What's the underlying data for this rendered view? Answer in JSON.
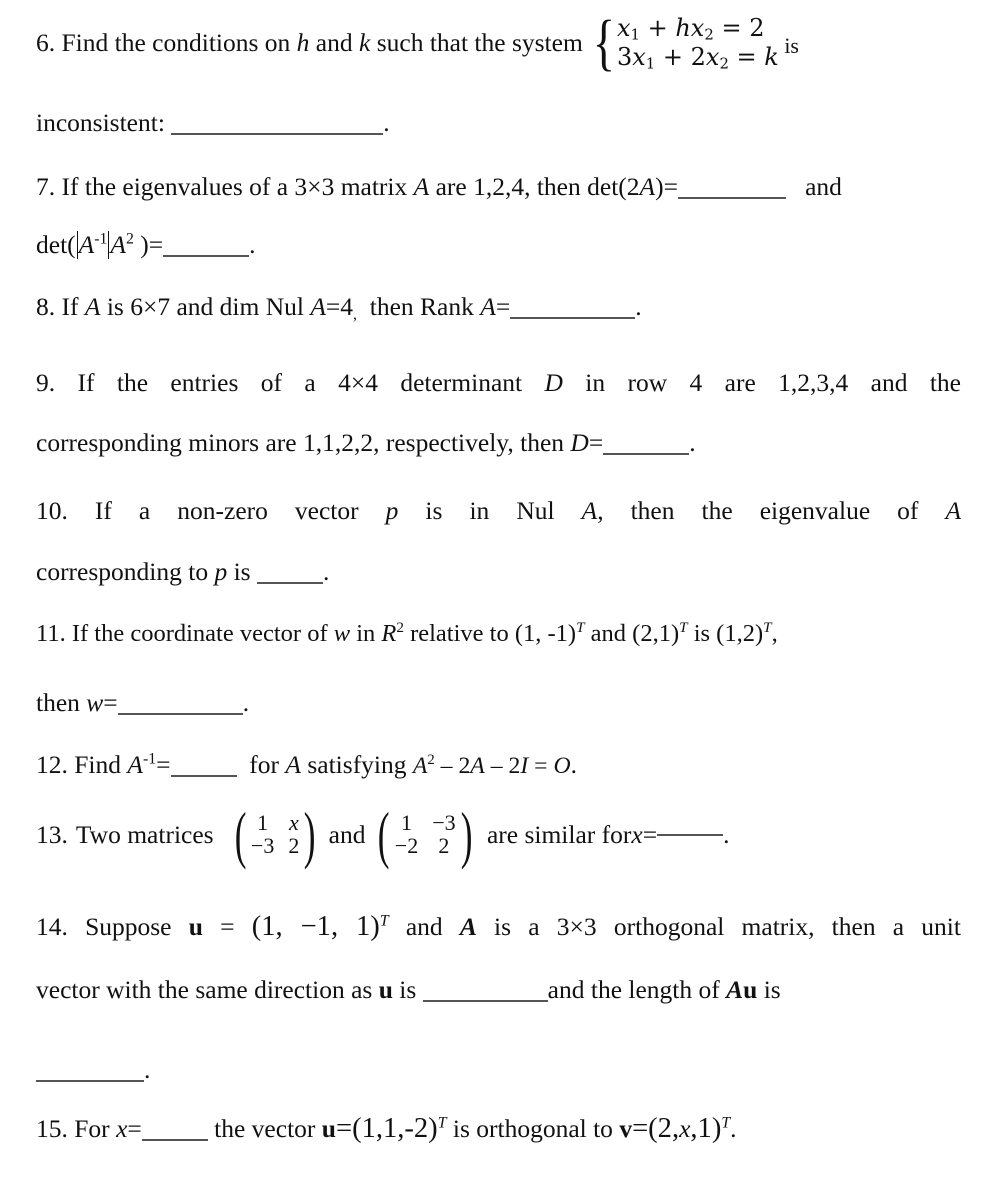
{
  "document": {
    "type": "linear-algebra-exam-worksheet",
    "questions": [
      {
        "number": "6.",
        "line1_before": "Find the conditions on ",
        "var_h": "h",
        "line1_mid": " and ",
        "var_k": "k",
        "line1_after": " such that the system ",
        "system": {
          "eq1": {
            "term1_base": "x",
            "term1_sub": "1",
            "plus": " + ",
            "term2_coef": "h",
            "term2_base": "x",
            "term2_sub": "2",
            "eq": " = ",
            "rhs": "2"
          },
          "eq2": {
            "term1_coef": "3",
            "term1_base": "x",
            "term1_sub": "1",
            "plus": " + ",
            "term2_coef": "2",
            "term2_base": "x",
            "term2_sub": "2",
            "eq": " = ",
            "rhs": "k"
          }
        },
        "line1_tail": "is",
        "line2": "inconsistent:",
        "line2_period": "."
      },
      {
        "number": "7.",
        "text_a": "If the eigenvalues of a 3×3 matrix ",
        "var_A": "A",
        "text_b": " are 1,2,4, then det(2",
        "var_A2": "A",
        "text_c": ")=",
        "text_d": "and",
        "line2_det": "det(",
        "line2_A1": "A",
        "line2_A1_sup": "-1",
        "line2_A2": "A",
        "line2_A2_sup": "2",
        "line2_close": " )=",
        "line2_period": "."
      },
      {
        "number": "8.",
        "text_a": "If ",
        "var_A": "A",
        "text_b": " is 6×7 and dim Nul ",
        "var_A2": "A",
        "text_c": "=4",
        "comma": ",",
        "text_d": "then Rank ",
        "var_A3": "A",
        "text_e": "=",
        "period": "."
      },
      {
        "number": "9.",
        "line1": "If the entries of a 4×4 determinant D in row 4 are 1,2,3,4 and the",
        "line1_pre": "If the entries of a 4×4 determinant ",
        "var_D": "D",
        "line1_post": " in row 4 are 1,2,3,4 and the",
        "line2_pre": "corresponding minors are 1,1,2,2, respectively, then ",
        "var_D2": "D",
        "line2_eq": "=",
        "line2_period": "."
      },
      {
        "number": "10.",
        "line1_pre": "If a non-zero vector ",
        "var_p": "p",
        "line1_mid": " is in Nul ",
        "var_A": "A",
        "line1_post": ", then the eigenvalue of ",
        "var_A2": "A",
        "line2_pre": "corresponding to ",
        "var_p2": "p",
        "line2_mid": " is ",
        "line2_period": "."
      },
      {
        "number": "11.",
        "line1_a": "If the coordinate vector of ",
        "var_w": "w",
        "line1_b": " in ",
        "var_R": "R",
        "var_R_sup": "2",
        "line1_c": " relative to (1, -1)",
        "sup_T1": "T",
        "line1_d": " and (2,1)",
        "sup_T2": "T",
        "line1_e": " is (1,2)",
        "sup_T3": "T",
        "line1_f": ",",
        "line2_pre": "then ",
        "var_w2": "w",
        "line2_eq": "=",
        "line2_period": "."
      },
      {
        "number": "12.",
        "text_a": "Find ",
        "var_A": "A",
        "var_A_sup": "-1",
        "text_b": "=",
        "text_c": "for ",
        "var_A2": "A",
        "text_d": " satisfying  ",
        "eq_A": "A",
        "eq_A_sup": "2",
        "eq_rest": " – 2",
        "eq_A2": "A",
        "eq_rest2": " – 2",
        "eq_I": "I",
        "eq_equals": " = ",
        "eq_O": "O",
        "period": "."
      },
      {
        "number": "13.",
        "text_a": "Two matrices",
        "matrix1": [
          [
            "1",
            "x"
          ],
          [
            "−3",
            "2"
          ]
        ],
        "matrix1_italic": [
          [
            false,
            true
          ],
          [
            false,
            false
          ]
        ],
        "text_and": "and",
        "matrix2": [
          [
            "1",
            "−3"
          ],
          [
            "−2",
            "2"
          ]
        ],
        "matrix2_italic": [
          [
            false,
            false
          ],
          [
            false,
            false
          ]
        ],
        "text_b": "are similar for ",
        "var_x": "x",
        "text_c": "=",
        "period": "."
      },
      {
        "number": "14.",
        "line1_a": "Suppose ",
        "var_u": "u",
        "line1_eq": " = ",
        "vec": "(1,  −1, 1)",
        "sup_T": "T",
        "line1_b": " and ",
        "var_A": "A",
        "line1_c": " is a 3×3 orthogonal matrix, then a unit",
        "line2_a": "vector with the same direction as ",
        "var_u2": "u",
        "line2_b": " is ",
        "line2_c": "and the length of ",
        "var_Au_A": "A",
        "var_Au_u": "u",
        "line2_d": " is",
        "line3_period": "."
      },
      {
        "number": "15.",
        "text_a": "For ",
        "var_x": "x",
        "text_b": "=",
        "text_c": " the vector ",
        "var_u": "u",
        "text_d": "=(1,1,-2)",
        "sup_T1": "T",
        "text_e": " is orthogonal to ",
        "var_v": "v",
        "text_f": "=(2,",
        "var_x2": "x",
        "text_g": ",1)",
        "sup_T2": "T",
        "period": "."
      }
    ]
  },
  "style": {
    "text_color": "#111111",
    "blank_color": "#555555",
    "background": "#ffffff"
  }
}
